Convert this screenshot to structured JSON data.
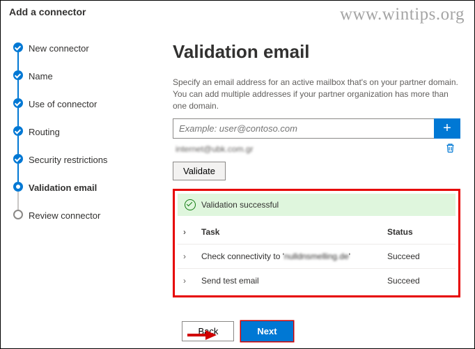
{
  "header": {
    "title": "Add a connector"
  },
  "watermark": "www.wintips.org",
  "sidebar": {
    "steps": [
      {
        "label": "New connector"
      },
      {
        "label": "Name"
      },
      {
        "label": "Use of connector"
      },
      {
        "label": "Routing"
      },
      {
        "label": "Security restrictions"
      },
      {
        "label": "Validation email"
      },
      {
        "label": "Review connector"
      }
    ]
  },
  "main": {
    "title": "Validation email",
    "description": "Specify an email address for an active mailbox that's on your partner domain. You can add multiple addresses if your partner organization has more than one domain.",
    "input_placeholder": "Example: user@contoso.com",
    "add_label": "+",
    "added_email": "internet@ubk.com.gr",
    "validate_label": "Validate",
    "success_message": "Validation successful",
    "table": {
      "task_header": "Task",
      "status_header": "Status",
      "rows": [
        {
          "task_prefix": "Check connectivity to '",
          "task_blurred": "nulldnsmelling.de",
          "task_suffix": "'",
          "status": "Succeed"
        },
        {
          "task_prefix": "Send test email",
          "task_blurred": "",
          "task_suffix": "",
          "status": "Succeed"
        }
      ]
    }
  },
  "footer": {
    "back_label": "Back",
    "next_label": "Next"
  }
}
